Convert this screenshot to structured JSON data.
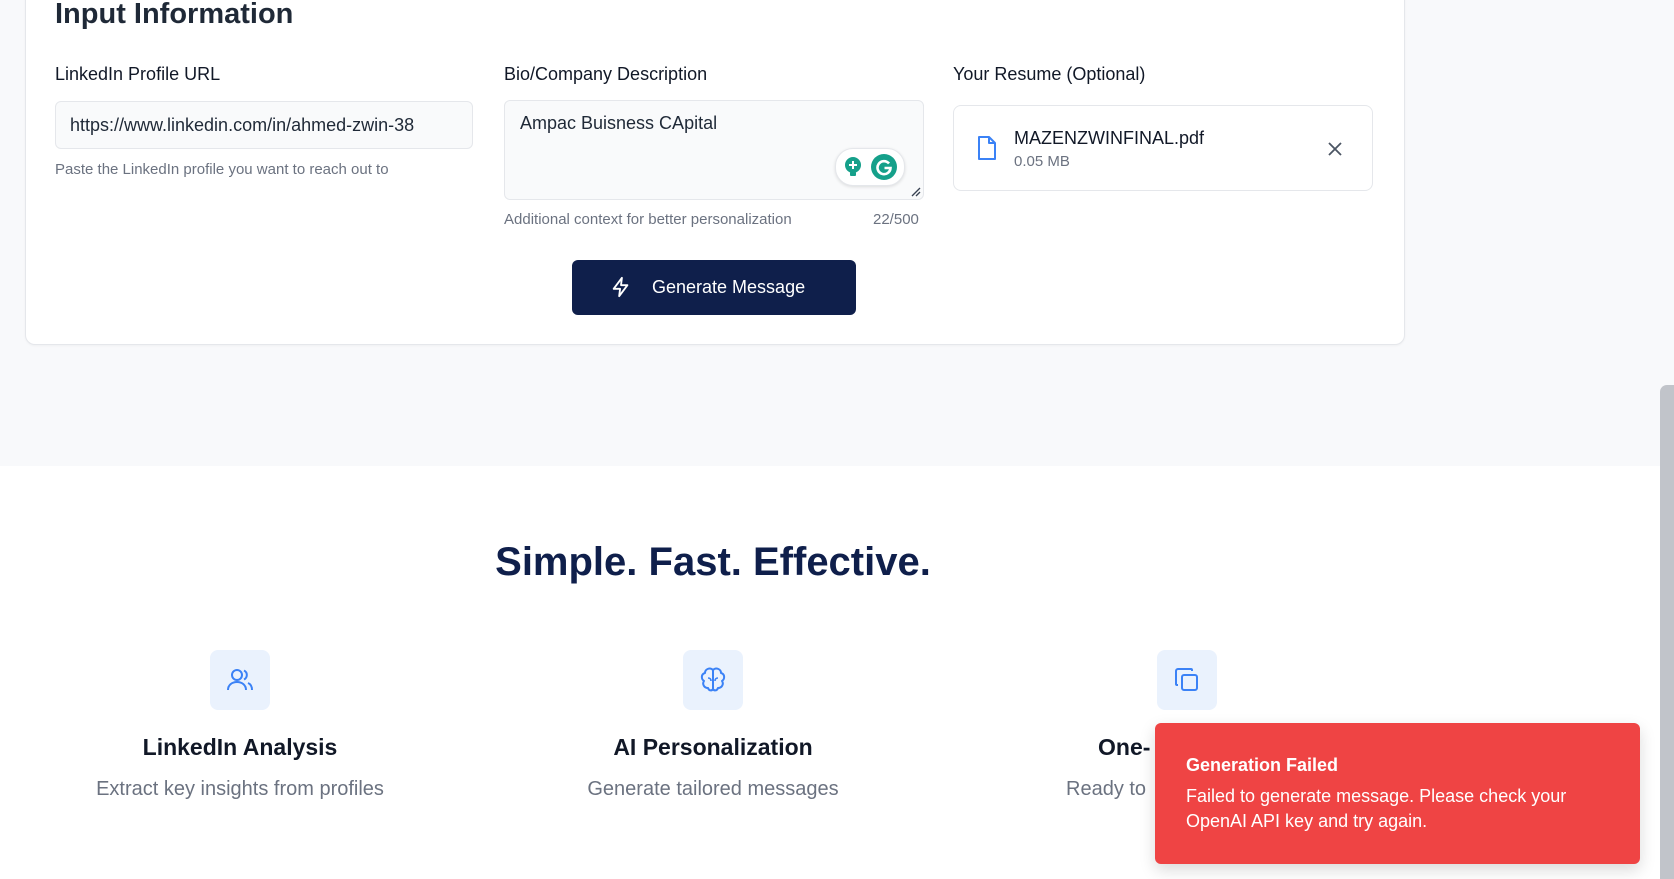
{
  "input_card": {
    "title": "Input Information",
    "linkedin": {
      "label": "LinkedIn Profile URL",
      "value": "https://www.linkedin.com/in/ahmed-zwin-38",
      "hint": "Paste the LinkedIn profile you want to reach out to"
    },
    "bio": {
      "label": "Bio/Company Description",
      "value": "Ampac Buisness CApital",
      "hint": "Additional context for better personalization",
      "counter": "22/500"
    },
    "resume": {
      "label": "Your Resume (Optional)",
      "file_name": "MAZENZWINFINAL.pdf",
      "file_size": "0.05 MB"
    },
    "generate_button": "Generate Message"
  },
  "features": {
    "headline": "Simple. Fast. Effective.",
    "items": [
      {
        "title": "LinkedIn Analysis",
        "desc": "Extract key insights from profiles",
        "icon": "users-icon"
      },
      {
        "title": "AI Personalization",
        "desc": "Generate tailored messages",
        "icon": "brain-icon"
      },
      {
        "title": "One-",
        "desc": "Ready to",
        "icon": "copy-icon"
      }
    ]
  },
  "toast": {
    "title": "Generation Failed",
    "message": "Failed to generate message. Please check your OpenAI API key and try again."
  },
  "colors": {
    "primary": "#0f1f4b",
    "accent_icon": "#3b82f6",
    "icon_bg": "#eaf2fd",
    "error": "#ef4444",
    "grammarly": "#15a08a"
  }
}
